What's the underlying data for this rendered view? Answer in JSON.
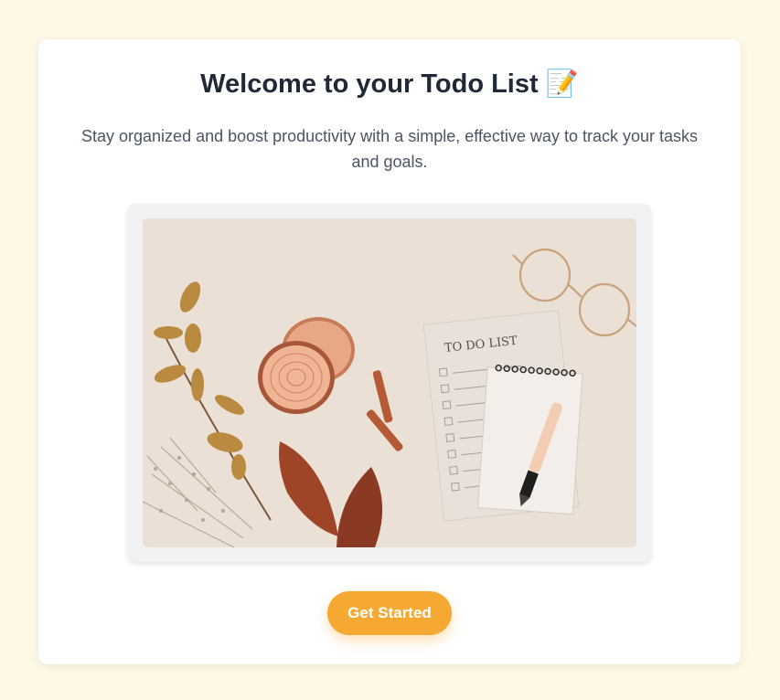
{
  "welcome": {
    "title": "Welcome to your Todo List 📝",
    "subtitle": "Stay organized and boost productivity with a simple, effective way to track your tasks and goals.",
    "hero_image_text": "TO DO LIST",
    "cta_label": "Get Started"
  },
  "colors": {
    "page_background": "#fef8e6",
    "card_background": "#ffffff",
    "cta": "#f5a832",
    "title_text": "#1f2937",
    "subtitle_text": "#4b5563"
  },
  "icons": {
    "title_emoji": "memo-icon"
  }
}
